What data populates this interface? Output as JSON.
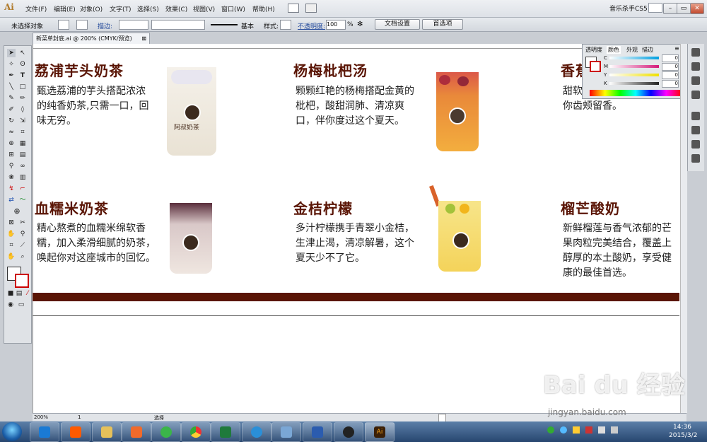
{
  "app": {
    "logo": "Ai",
    "menu": [
      "文件(F)",
      "编辑(E)",
      "对象(O)",
      "文字(T)",
      "选择(S)",
      "效果(C)",
      "视图(V)",
      "窗口(W)",
      "帮助(H)"
    ],
    "brand": "音乐杀手CS5"
  },
  "control_bar": {
    "selection": "未选择对象",
    "stroke_label": "描边:",
    "basic": "基本",
    "style_label": "样式:",
    "opacity_label": "不透明度:",
    "opacity_value": "100",
    "opacity_unit": "%",
    "doc_setup": "文档设置",
    "preferences": "首选项"
  },
  "document": {
    "tab_title": "新菜单封底.ai @ 200% (CMYK/预览)",
    "zoom": "200%",
    "page": "1",
    "status": "选择"
  },
  "color_panel": {
    "tabs": [
      "透明度",
      "颜色",
      "外观",
      "描边"
    ],
    "channels": [
      {
        "label": "C",
        "value": "0",
        "color": "#00a0e0"
      },
      {
        "label": "M",
        "value": "0",
        "color": "#d4197a"
      },
      {
        "label": "Y",
        "value": "0",
        "color": "#f0e000"
      },
      {
        "label": "K",
        "value": "0",
        "color": "#222222"
      }
    ],
    "unit": "%"
  },
  "menu_items": [
    {
      "title": "荔浦芋头奶茶",
      "desc": "甄选荔浦的芋头搭配浓浓的纯香奶茶,只需一口，回味无穷。"
    },
    {
      "title": "杨梅枇杷汤",
      "desc": "颗颗红艳的杨梅搭配金黄的枇杷，酸甜润肺、清凉爽口，伴你度过这个夏天。"
    },
    {
      "title": "香蕉",
      "desc": "甜软椰奶，风味独特，让你齿颊留香。"
    },
    {
      "title": "血糯米奶茶",
      "desc": "精心熬煮的血糯米绵软香糯，加入柔滑细腻的奶茶，唤起你对这座城市的回忆。"
    },
    {
      "title": "金桔柠檬",
      "desc": "多汁柠檬携手青翠小金桔，生津止渴，清凉解暑，这个夏天少不了它。"
    },
    {
      "title": "榴芒酸奶",
      "desc": "新鲜榴莲与香气浓郁的芒果肉粒完美结合，覆盖上醇厚的本土酸奶，享受健康的最佳首选。"
    }
  ],
  "cup_brand": "阿叔奶茶",
  "taskbar": {
    "time": "14:36",
    "date": "2015/3/2"
  },
  "watermark": {
    "text": "Bai du 经验",
    "sub": "jingyan.baidu.com"
  }
}
